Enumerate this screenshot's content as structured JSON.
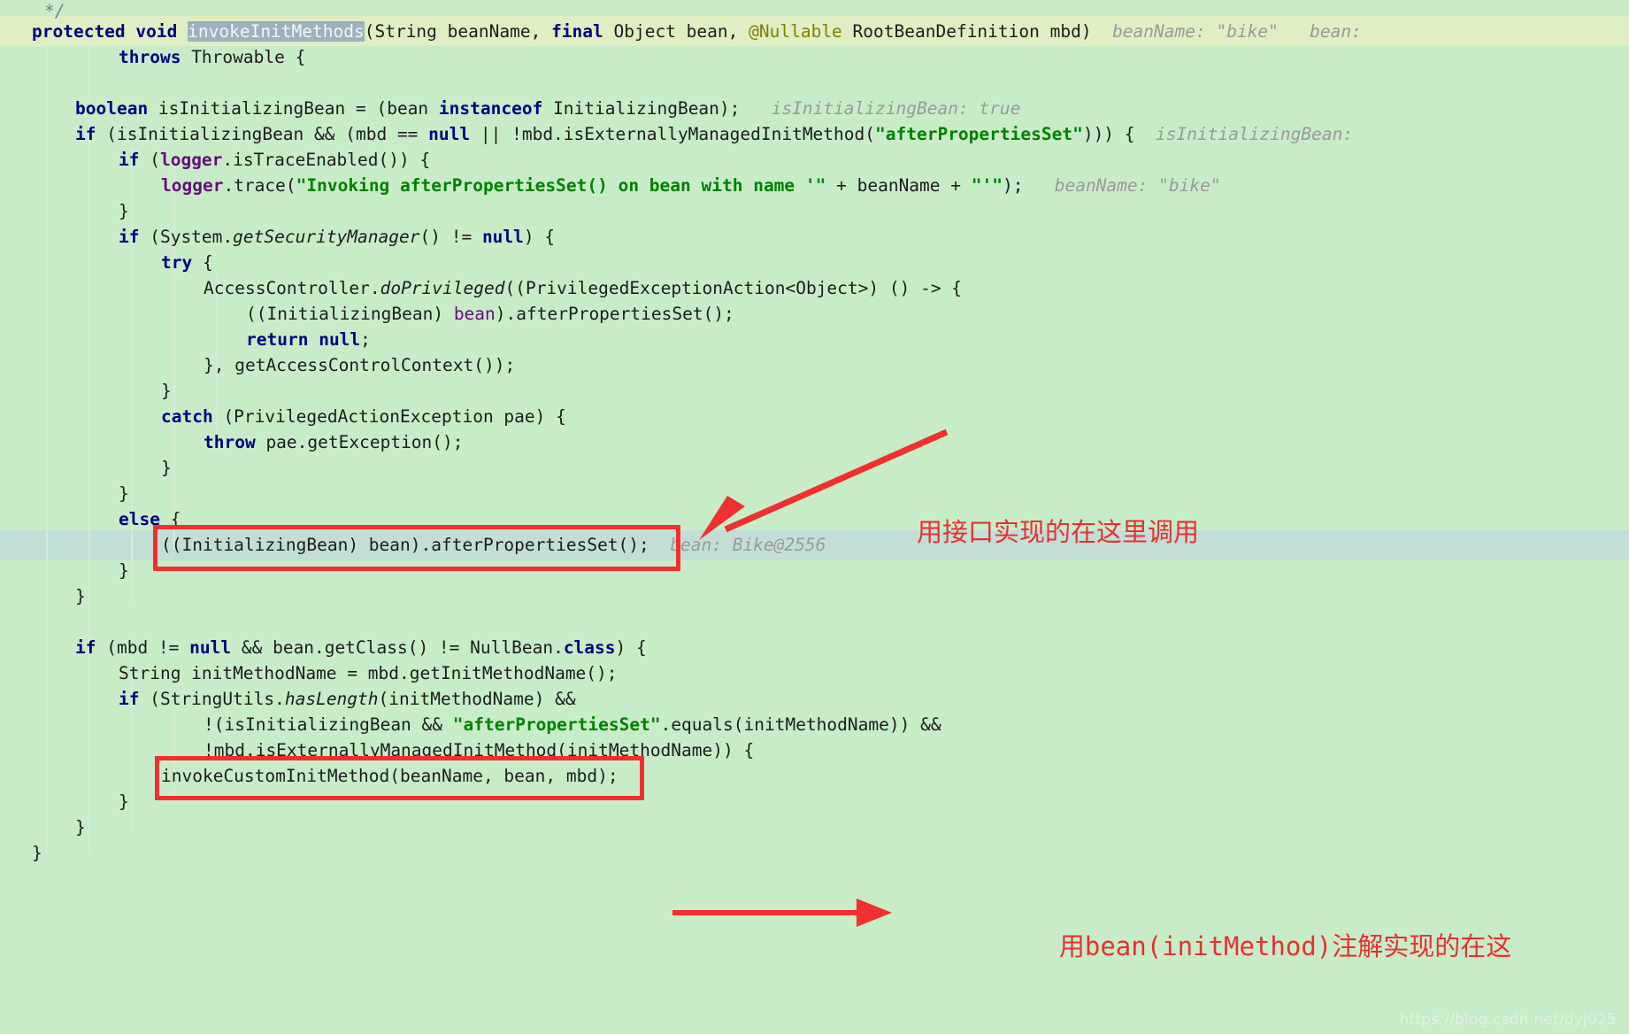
{
  "editor": {
    "background_color": "#c8ecc8",
    "declaration_row_highlight_color": "#e0eec4",
    "execution_row_highlight_color": "#c3ded7",
    "selection_color": "#9cb3bf",
    "keyword_color": "#000080",
    "string_color": "#008000",
    "field_color": "#660e7a",
    "hint_color": "#9a9a9a",
    "annotation_color": "#e83030"
  },
  "code": {
    "line_01": {
      "comment": "*/"
    },
    "line_02": {
      "kw_protected": "protected",
      "kw_void": "void",
      "method_name": "invokeInitMethods",
      "signature": "(String beanName, ",
      "kw_final": "final",
      "sig_rest": " Object bean, ",
      "annotation": "@Nullable",
      "sig_tail": " RootBeanDefinition mbd)",
      "hint": "beanName: \"bike\"   bean:"
    },
    "line_03": {
      "kw_throws": "throws",
      "rest": " Throwable {"
    },
    "line_04": {
      "kw_boolean": "boolean",
      "mid": " isInitializingBean = (bean ",
      "kw_instanceof": "instanceof",
      "tail": " InitializingBean);",
      "hint": "isInitializingBean: true"
    },
    "line_05": {
      "kw_if": "if",
      "mid": " (isInitializingBean && (mbd == ",
      "kw_null": "null",
      "mid2": " || !mbd.isExternallyManagedInitMethod(",
      "str": "\"afterPropertiesSet\"",
      "tail": "))) {",
      "hint": "isInitializingBean:"
    },
    "line_06": {
      "kw_if": "if",
      "mid": " (",
      "field_logger": "logger",
      "tail": ".isTraceEnabled()) {"
    },
    "line_07": {
      "field_logger": "logger",
      "mid": ".trace(",
      "str": "\"Invoking afterPropertiesSet() on bean with name '\"",
      "mid2": " + beanName + ",
      "str2": "\"'\"",
      "tail": ");",
      "hint": "beanName: \"bike\""
    },
    "line_08": {
      "text": "}"
    },
    "line_09": {
      "kw_if": "if",
      "mid": " (System.",
      "static_call": "getSecurityManager",
      "mid2": "() != ",
      "kw_null": "null",
      "tail": ") {"
    },
    "line_10": {
      "kw_try": "try",
      "tail": " {"
    },
    "line_11": {
      "pre": "AccessController.",
      "static_call": "doPrivileged",
      "tail": "((PrivilegedExceptionAction<Object>) () -> {"
    },
    "line_12": {
      "pre": "((InitializingBean) ",
      "param_bean": "bean",
      "tail": ").afterPropertiesSet();"
    },
    "line_13": {
      "kw_return": "return",
      "kw_null": "null",
      "tail": ";"
    },
    "line_14": {
      "text": "}, getAccessControlContext());"
    },
    "line_15": {
      "text": "}"
    },
    "line_16": {
      "kw_catch": "catch",
      "tail": " (PrivilegedActionException pae) {"
    },
    "line_17": {
      "kw_throw": "throw",
      "tail": " pae.getException();"
    },
    "line_18": {
      "text": "}"
    },
    "line_19": {
      "text": "}"
    },
    "line_20": {
      "kw_else": "else",
      "tail": " {"
    },
    "line_21": {
      "text": "((InitializingBean) bean).afterPropertiesSet();",
      "hint": "bean: Bike@2556"
    },
    "line_22": {
      "text": "}"
    },
    "line_23": {
      "text": "}"
    },
    "line_24": {
      "kw_if": "if",
      "mid": " (mbd != ",
      "kw_null": "null",
      "mid2": " && bean.getClass() != NullBean.",
      "kw_class": "class",
      "tail": ") {"
    },
    "line_25": {
      "text": "String initMethodName = mbd.getInitMethodName();"
    },
    "line_26": {
      "kw_if": "if",
      "mid": " (StringUtils.",
      "static_call": "hasLength",
      "tail": "(initMethodName) &&"
    },
    "line_27": {
      "pre": "!(isInitializingBean && ",
      "str": "\"afterPropertiesSet\"",
      "tail": ".equals(initMethodName)) &&"
    },
    "line_28": {
      "text": "!mbd.isExternallyManagedInitMethod(initMethodName)) {"
    },
    "line_29": {
      "text": "invokeCustomInitMethod(beanName, bean, mbd);"
    },
    "line_30": {
      "text": "}"
    },
    "line_31": {
      "text": "}"
    },
    "line_32": {
      "text": "}"
    }
  },
  "annotations": {
    "note_interface": "用接口实现的在这里调用",
    "note_initmethod_prefix": "用",
    "note_initmethod_mono": "bean(initMethod)",
    "note_initmethod_suffix": "注解实现的在这"
  },
  "watermark": {
    "text": "https://blog.csdn.net/dyj025"
  }
}
